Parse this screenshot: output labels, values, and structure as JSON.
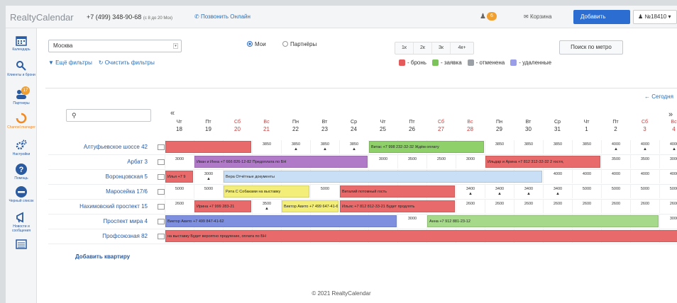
{
  "app": {
    "logo": "RealtyCalendar",
    "phone": "+7 (499) 348-90-68",
    "phone_hours": "(с 8 до 20 Мск)",
    "call_online": "Позвонить Онлайн",
    "notifications_count": "6",
    "cart_label": "Корзина",
    "add_button": "Добавить",
    "account_label": "№18410"
  },
  "sidebar": {
    "items": [
      {
        "label": "Календарь",
        "icon": "calendar-icon"
      },
      {
        "label": "Клиенты и брони",
        "icon": "clients-icon"
      },
      {
        "label": "Партнеры",
        "icon": "partners-icon",
        "badge": "17"
      },
      {
        "label": "Channel manager",
        "icon": "channel-manager-icon"
      },
      {
        "label": "Настройки",
        "icon": "gear-icon"
      },
      {
        "label": "Помощь",
        "icon": "help-icon"
      },
      {
        "label": "Черный список",
        "icon": "blacklist-icon"
      },
      {
        "label": "Новости и сообщения",
        "icon": "megaphone-icon"
      },
      {
        "label": "",
        "icon": "list-icon"
      }
    ]
  },
  "filters": {
    "city": "Москва",
    "radio_mine": "Мои",
    "radio_partners": "Партнёры",
    "zoom_options": [
      "1к",
      "2к",
      "3к",
      "4к+"
    ],
    "metro_button": "Поиск по метро",
    "more_filters": "Ещё фильтры",
    "clear_filters": "Очистить фильтры"
  },
  "legend": [
    {
      "label": "- бронь",
      "color": "#e55b5b"
    },
    {
      "label": "- заявка",
      "color": "#7cc45a"
    },
    {
      "label": "- отменена",
      "color": "#9aa0a6"
    },
    {
      "label": "- удаленные",
      "color": "#9a9ee8"
    }
  ],
  "calendar": {
    "today_link": "Сегодня",
    "prev": "«",
    "next": "»",
    "days": [
      {
        "dn": "Чт",
        "dd": "18",
        "we": false
      },
      {
        "dn": "Пт",
        "dd": "19",
        "we": false
      },
      {
        "dn": "Сб",
        "dd": "20",
        "we": true
      },
      {
        "dn": "Вс",
        "dd": "21",
        "we": true
      },
      {
        "dn": "Пн",
        "dd": "22",
        "we": false
      },
      {
        "dn": "Вт",
        "dd": "23",
        "we": false
      },
      {
        "dn": "Ср",
        "dd": "24",
        "we": false
      },
      {
        "dn": "Чт",
        "dd": "25",
        "we": false
      },
      {
        "dn": "Пт",
        "dd": "26",
        "we": false
      },
      {
        "dn": "Сб",
        "dd": "27",
        "we": true
      },
      {
        "dn": "Вс",
        "dd": "28",
        "we": true
      },
      {
        "dn": "Пн",
        "dd": "29",
        "we": false
      },
      {
        "dn": "Вт",
        "dd": "30",
        "we": false
      },
      {
        "dn": "Ср",
        "dd": "31",
        "we": false
      },
      {
        "dn": "Чт",
        "dd": "1",
        "we": false
      },
      {
        "dn": "Пт",
        "dd": "2",
        "we": false
      },
      {
        "dn": "Сб",
        "dd": "3",
        "we": true
      },
      {
        "dn": "Вс",
        "dd": "4",
        "we": true
      }
    ],
    "rows": [
      {
        "name": "Алтуфьевское шоссе 42",
        "cells": [
          "",
          "",
          "",
          "3850",
          "3850",
          "3850",
          "3850",
          "",
          "",
          "",
          "",
          "3850",
          "3850",
          "3850",
          "3850",
          "4000",
          "4000",
          "4000"
        ],
        "tri": [
          false,
          false,
          false,
          false,
          true,
          true,
          true,
          false,
          false,
          false,
          false,
          false,
          false,
          false,
          false,
          true,
          true,
          true
        ],
        "bars": [
          {
            "start": 0,
            "span": 3,
            "text": "",
            "color": "#e86a6a"
          },
          {
            "start": 7,
            "span": 4,
            "text": "Витас +7 998 232-32-32 Ждём оплату",
            "color": "#8fd06a"
          }
        ]
      },
      {
        "name": "Арбат 3",
        "cells": [
          "3000",
          "",
          "",
          "",
          "",
          "",
          "",
          "3000",
          "3500",
          "2500",
          "3000",
          "",
          "",
          "",
          "",
          "3500",
          "3500",
          "3000"
        ],
        "tri": [
          false,
          false,
          false,
          false,
          false,
          false,
          false,
          false,
          false,
          false,
          false,
          false,
          false,
          false,
          false,
          false,
          false,
          false
        ],
        "bars": [
          {
            "start": 1,
            "span": 6,
            "text": "Иван и Инна +7 666 826-12-82 Предоплата по БН",
            "color": "#b07ac8"
          },
          {
            "start": 11,
            "span": 4,
            "text": "Ильдар и Арина +7 812 312-32-32 2 гостя,",
            "color": "#e86a6a"
          }
        ]
      },
      {
        "name": "Воронцовская 5",
        "cells": [
          "",
          "3000",
          "",
          "",
          "",
          "",
          "",
          "",
          "",
          "",
          "",
          "",
          "",
          "4000",
          "4000",
          "4000",
          "4000",
          "4000"
        ],
        "tri": [
          false,
          true,
          false,
          false,
          false,
          false,
          false,
          false,
          false,
          false,
          false,
          false,
          false,
          false,
          false,
          false,
          false,
          false
        ],
        "bars": [
          {
            "start": 0,
            "span": 1,
            "text": "Илья +7 9",
            "color": "#e86a6a"
          },
          {
            "start": 2,
            "span": 11,
            "text": "Вера Отчётные документы",
            "color": "#c9dff5"
          }
        ]
      },
      {
        "name": "Маросейка 17/6",
        "cells": [
          "5000",
          "5000",
          "",
          "",
          "",
          "5000",
          "",
          "",
          "",
          "",
          "3400",
          "3400",
          "3400",
          "3400",
          "5000",
          "5000",
          "5000",
          "5000"
        ],
        "tri": [
          false,
          false,
          false,
          false,
          false,
          false,
          false,
          false,
          false,
          false,
          true,
          true,
          true,
          true,
          false,
          false,
          false,
          false
        ],
        "bars": [
          {
            "start": 2,
            "span": 3,
            "text": "Рита С Собаками на выставку",
            "color": "#f3ee7a"
          },
          {
            "start": 6,
            "span": 4,
            "text": "Виталий потомный гость",
            "color": "#e86a6a"
          }
        ]
      },
      {
        "name": "Нахимовский проспект 15",
        "cells": [
          "2600",
          "",
          "",
          "3500",
          "",
          "",
          "",
          "",
          "",
          "",
          "2600",
          "2600",
          "2600",
          "2600",
          "2600",
          "2600",
          "2600",
          "2600"
        ],
        "tri": [
          false,
          false,
          false,
          true,
          false,
          false,
          false,
          false,
          false,
          false,
          false,
          false,
          false,
          false,
          false,
          false,
          false,
          false
        ],
        "bars": [
          {
            "start": 1,
            "span": 2,
            "text": "Ирина +7 999 283-21",
            "color": "#e86a6a"
          },
          {
            "start": 4,
            "span": 2,
            "text": "Виктор Авито +7 499 647-41-62",
            "color": "#f3ee7a"
          },
          {
            "start": 6,
            "span": 4,
            "text": "Ильяс +7 812 812-33-21 Будет продлять",
            "color": "#e86a6a"
          }
        ]
      },
      {
        "name": "Проспект мира 4",
        "cells": [
          "",
          "",
          "",
          "",
          "",
          "",
          "",
          "",
          "3000",
          "",
          "",
          "",
          "",
          "",
          "",
          "",
          "",
          "3000"
        ],
        "tri": [
          false,
          false,
          false,
          false,
          false,
          false,
          false,
          false,
          false,
          false,
          false,
          false,
          false,
          false,
          false,
          false,
          false,
          false
        ],
        "bars": [
          {
            "start": 0,
            "span": 8,
            "text": "Виктор Авито +7 499 847-41-62",
            "color": "#7f8fe0"
          },
          {
            "start": 9,
            "span": 8,
            "text": "Анна +7 912 881-23-12",
            "color": "#a6d98a"
          }
        ]
      },
      {
        "name": "Профсоюзная 82",
        "cells": [
          "",
          "",
          "",
          "",
          "",
          "",
          "",
          "",
          "",
          "",
          "",
          "",
          "",
          "",
          "",
          "",
          "",
          ""
        ],
        "tri": [
          false,
          false,
          false,
          false,
          false,
          false,
          false,
          false,
          false,
          false,
          false,
          false,
          false,
          false,
          false,
          false,
          false,
          false
        ],
        "bars": [
          {
            "start": 0,
            "span": 18,
            "text": "на выставку Будет вероятно продление, оплата по БН",
            "color": "#e86a6a"
          }
        ]
      }
    ],
    "add_apartment": "Добавить квартиру"
  },
  "footer": "© 2021 RealtyCalendar"
}
